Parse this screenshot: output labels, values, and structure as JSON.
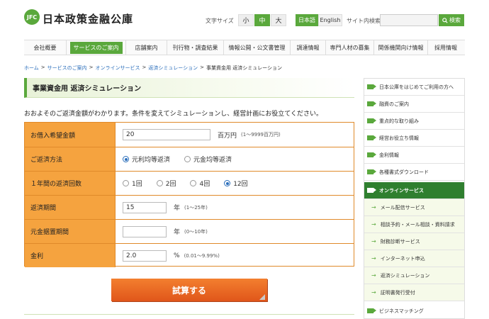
{
  "header": {
    "logo_mark": "JFC",
    "logo_text": "日本政策金融公庫",
    "font_size_label": "文字サイズ",
    "font_sizes": [
      "小",
      "中",
      "大"
    ],
    "languages": [
      "日本語",
      "English"
    ],
    "site_search_label": "サイト内検索",
    "search_placeholder": "",
    "search_button": "検索"
  },
  "gnav": [
    "会社概要",
    "サービスのご案内",
    "店舗案内",
    "刊行物・調査結果",
    "情報公開・公文書管理",
    "調達情報",
    "専門人材の募集",
    "関係機関向け情報",
    "採用情報"
  ],
  "breadcrumb": [
    "ホーム",
    "サービスのご案内",
    "オンラインサービス",
    "返済シミュレーション",
    "事業資金用 返済シミュレーション"
  ],
  "page_title": "事業資金用 返済シミュレーション",
  "intro": "おおよそのご返済金額がわかります。条件を変えてシミュレーションし、経営計画にお役立てください。",
  "form": {
    "loan_amount": {
      "label": "お借入希望金額",
      "value": "20",
      "unit": "百万円",
      "hint": "(1〜9999百万円)"
    },
    "repayment_method": {
      "label": "ご返済方法",
      "options": [
        "元利均等返済",
        "元金均等返済"
      ],
      "selected": 0
    },
    "payments_per_year": {
      "label": "１年間の返済回数",
      "options": [
        "1回",
        "2回",
        "4回",
        "12回"
      ],
      "selected": 3
    },
    "repayment_period": {
      "label": "返済期間",
      "value": "15",
      "unit": "年",
      "hint": "(1〜25年)"
    },
    "grace_period": {
      "label": "元金据置期間",
      "value": "",
      "unit": "年",
      "hint": "(0〜10年)"
    },
    "interest_rate": {
      "label": "金利",
      "value": "2.0",
      "unit": "%",
      "hint": "(0.01〜9.99%)"
    },
    "submit": "試算する"
  },
  "sidebar": {
    "items": [
      "日本公庫をはじめてご利用の方へ",
      "融資のご案内",
      "重点的な取り組み",
      "経営お役立ち情報",
      "金利情報",
      "各種書式ダウンロード",
      "オンラインサービス"
    ],
    "sub_items": [
      "メール配信サービス",
      "相談予約・メール相談・資料請求",
      "財務診断サービス",
      "インターネット申込",
      "返済シミュレーション",
      "証明書発行受付"
    ],
    "after": [
      "ビジネスマッチング"
    ]
  }
}
